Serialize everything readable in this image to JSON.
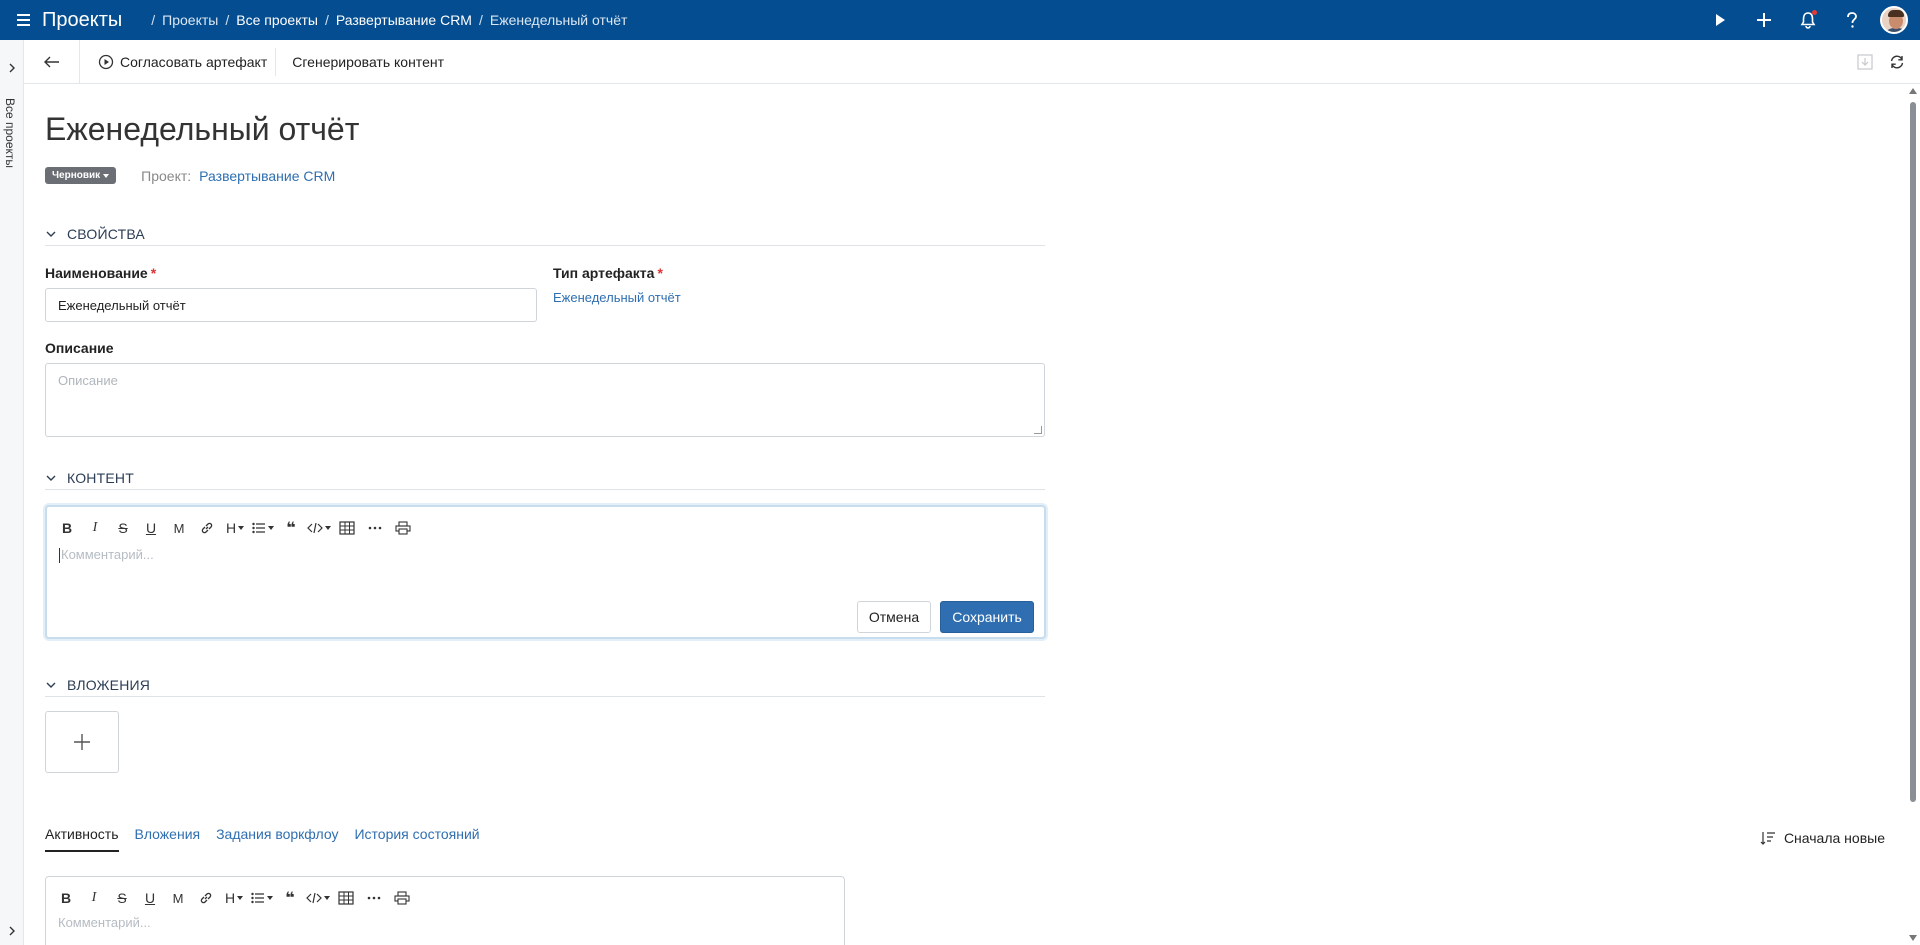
{
  "topbar": {
    "app_title": "Проекты",
    "breadcrumbs": [
      "Проекты",
      "Все проекты",
      "Развертывание CRM",
      "Еженедельный отчёт"
    ]
  },
  "sidebar": {
    "label": "Все проекты"
  },
  "toolbar": {
    "approve_label": "Согласовать артефакт",
    "generate_label": "Сгенерировать контент"
  },
  "artifact": {
    "title": "Еженедельный отчёт",
    "status": "Черновик",
    "project_label": "Проект:",
    "project_value": "Развертывание CRM"
  },
  "properties": {
    "section_title": "СВОЙСТВА",
    "name_label": "Наименование",
    "name_value": "Еженедельный отчёт",
    "type_label": "Тип артефакта",
    "type_value": "Еженедельный отчёт",
    "description_label": "Описание",
    "description_placeholder": "Описание"
  },
  "content": {
    "section_title": "КОНТЕНТ",
    "placeholder": "Комментарий...",
    "cancel_label": "Отмена",
    "save_label": "Сохранить"
  },
  "attachments": {
    "section_title": "ВЛОЖЕНИЯ"
  },
  "activity": {
    "tabs": [
      {
        "label": "Активность",
        "active": true
      },
      {
        "label": "Вложения",
        "active": false
      },
      {
        "label": "Задания воркфлоу",
        "active": false
      },
      {
        "label": "История состояний",
        "active": false
      }
    ],
    "sort_label": "Сначала новые",
    "comment_placeholder": "Комментарий..."
  },
  "colors": {
    "topbar": "#044d90",
    "link": "#2f6fb1",
    "primary_button": "#2f6fb1",
    "status_badge": "#6b6f75",
    "required": "#dd3333"
  }
}
